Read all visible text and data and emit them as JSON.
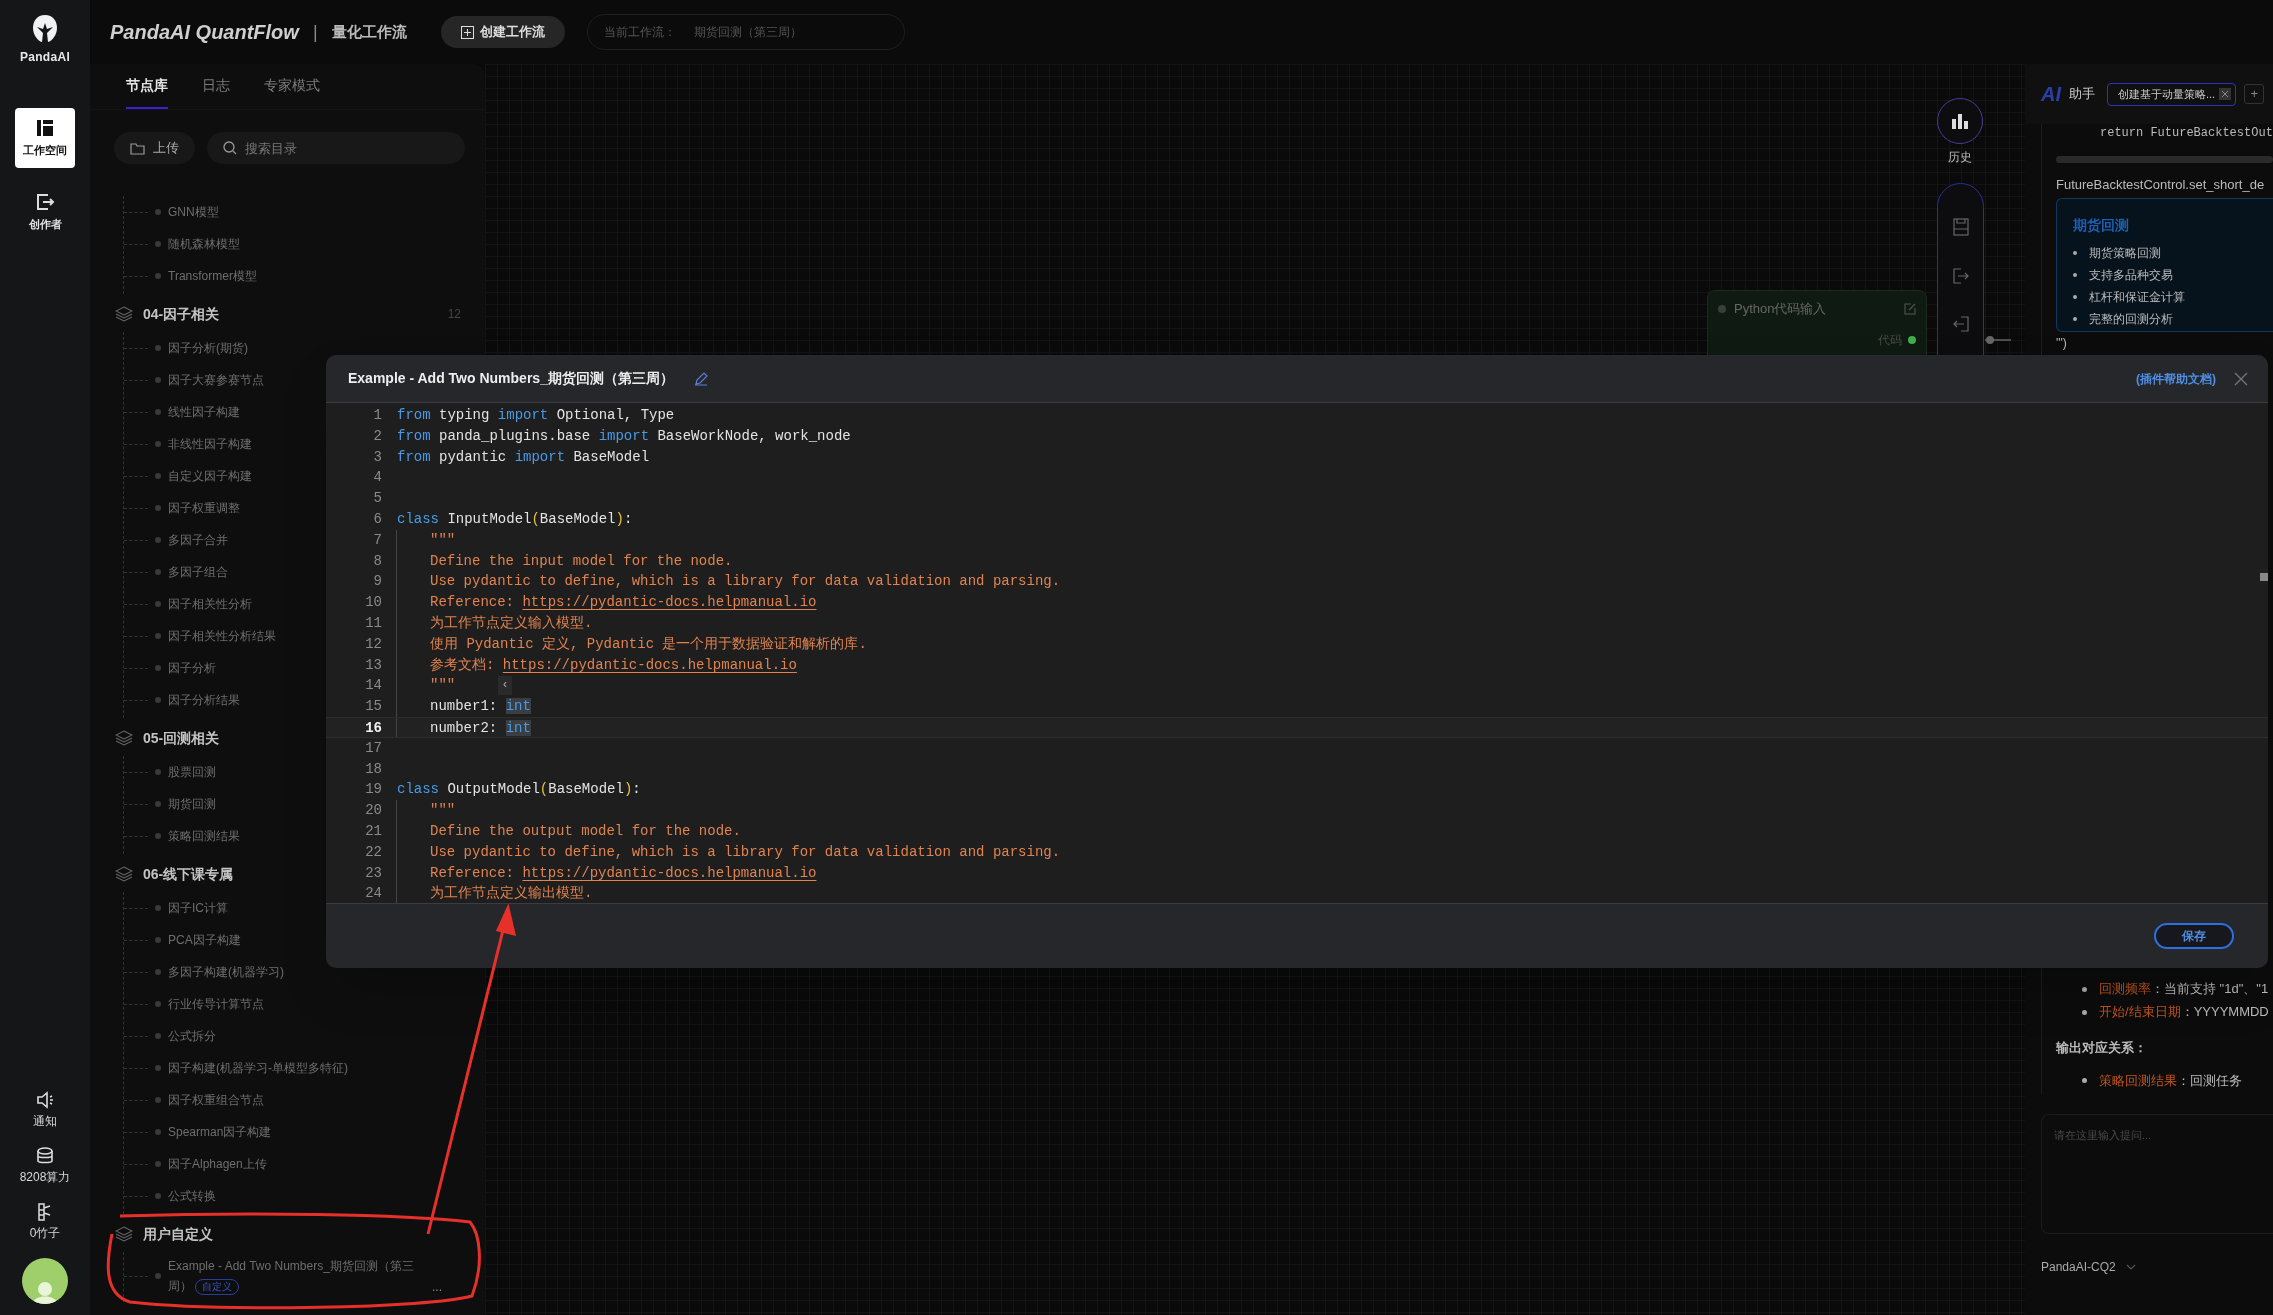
{
  "rail": {
    "logo_text": "PandaAI",
    "top_items": [
      {
        "label": "工作空间",
        "selected": true
      },
      {
        "label": "创作者",
        "selected": false
      }
    ],
    "bottom_items": [
      {
        "label": "通知"
      },
      {
        "label": "8208算力"
      },
      {
        "label": "0竹子"
      }
    ]
  },
  "header": {
    "app_title": "PandaAI QuantFlow",
    "separator": "|",
    "subtitle": "量化工作流",
    "create_button": "创建工作流",
    "current_label": "当前工作流：",
    "current_value": "期货回测（第三周）"
  },
  "library": {
    "tabs": [
      {
        "label": "节点库",
        "selected": true
      },
      {
        "label": "日志",
        "selected": false
      },
      {
        "label": "专家模式",
        "selected": false
      }
    ],
    "upload_button": "上传",
    "search": {
      "placeholder": "搜索目录"
    },
    "groups": [
      {
        "items": [
          {
            "label": "GNN模型"
          },
          {
            "label": "随机森林模型"
          },
          {
            "label": "Transformer模型"
          }
        ]
      },
      {
        "title": "04-因子相关",
        "count": "12",
        "items": [
          {
            "label": "因子分析(期货)"
          },
          {
            "label": "因子大赛参赛节点"
          },
          {
            "label": "线性因子构建"
          },
          {
            "label": "非线性因子构建"
          },
          {
            "label": "自定义因子构建"
          },
          {
            "label": "因子权重调整"
          },
          {
            "label": "多因子合并"
          },
          {
            "label": "多因子组合"
          },
          {
            "label": "因子相关性分析"
          },
          {
            "label": "因子相关性分析结果"
          },
          {
            "label": "因子分析"
          },
          {
            "label": "因子分析结果"
          }
        ]
      },
      {
        "title": "05-回测相关",
        "items": [
          {
            "label": "股票回测"
          },
          {
            "label": "期货回测"
          },
          {
            "label": "策略回测结果"
          }
        ]
      },
      {
        "title": "06-线下课专属",
        "items": [
          {
            "label": "因子IC计算"
          },
          {
            "label": "PCA因子构建"
          },
          {
            "label": "多因子构建(机器学习)"
          },
          {
            "label": "行业传导计算节点"
          },
          {
            "label": "公式拆分"
          },
          {
            "label": "因子构建(机器学习-单模型多特征)"
          },
          {
            "label": "因子权重组合节点"
          },
          {
            "label": "Spearman因子构建"
          },
          {
            "label": "因子Alphagen上传"
          },
          {
            "label": "公式转换"
          }
        ]
      },
      {
        "title": "用户自定义",
        "items": [
          {
            "label": "Example - Add Two Numbers_期货回测（第三周）",
            "tag": "自定义",
            "more": "..."
          }
        ]
      }
    ]
  },
  "canvas": {
    "history_label": "历史",
    "node": {
      "title": "Python代码输入",
      "port": "代码"
    }
  },
  "assistant": {
    "logo": "AI",
    "title": "助手",
    "chat_tab": "创建基于动量策略...",
    "add_button": "+",
    "code_line": "return FutureBacktestOut",
    "control_line": "FutureBacktestControl.set_short_de",
    "card": {
      "title": "期货回测",
      "bullets": [
        "期货策略回测",
        "支持多品种交易",
        "杠杆和保证金计算",
        "完整的回测分析"
      ]
    },
    "closing": "''')",
    "params": [
      {
        "key": "回测频率",
        "text": "：当前支持 \"1d\"、\"1"
      },
      {
        "key": "开始/结束日期",
        "text": "：YYYYMMDD"
      }
    ],
    "output_heading": "输出对应关系：",
    "outputs": [
      {
        "key": "策略回测结果",
        "text": "：回测任务"
      }
    ],
    "input": {
      "placeholder": "请在这里输入提问..."
    },
    "model": "PandaAI-CQ2"
  },
  "editor": {
    "title": "Example - Add Two Numbers_期货回测（第三周）",
    "help_link": "(插件帮助文档)",
    "save_button": "保存",
    "collapse_handle": "‹",
    "lines": [
      {
        "n": "1",
        "current": false,
        "block": false,
        "tokens": [
          {
            "kind": "kw",
            "text": "from"
          },
          {
            "kind": "plain",
            "text": " typing "
          },
          {
            "kind": "kw",
            "text": "import"
          },
          {
            "kind": "plain",
            "text": " Optional, Type"
          }
        ]
      },
      {
        "n": "2",
        "current": false,
        "block": false,
        "tokens": [
          {
            "kind": "kw",
            "text": "from"
          },
          {
            "kind": "plain",
            "text": " panda_plugins.base "
          },
          {
            "kind": "kw",
            "text": "import"
          },
          {
            "kind": "plain",
            "text": " BaseWorkNode, work_node"
          }
        ]
      },
      {
        "n": "3",
        "current": false,
        "block": false,
        "tokens": [
          {
            "kind": "kw",
            "text": "from"
          },
          {
            "kind": "plain",
            "text": " pydantic "
          },
          {
            "kind": "kw",
            "text": "import"
          },
          {
            "kind": "plain",
            "text": " BaseModel"
          }
        ]
      },
      {
        "n": "4",
        "current": false,
        "block": false
      },
      {
        "n": "5",
        "current": false,
        "block": false
      },
      {
        "n": "6",
        "current": false,
        "block": false,
        "tokens": [
          {
            "kind": "kw",
            "text": "class"
          },
          {
            "kind": "plain",
            "text": " InputModel"
          },
          {
            "kind": "paren",
            "text": "("
          },
          {
            "kind": "plain",
            "text": "BaseModel"
          },
          {
            "kind": "paren",
            "text": ")"
          },
          {
            "kind": "plain",
            "text": ":"
          }
        ]
      },
      {
        "n": "7",
        "current": false,
        "block": true,
        "tokens": [
          {
            "kind": "str",
            "text": "\"\"\""
          }
        ]
      },
      {
        "n": "8",
        "current": false,
        "block": true,
        "tokens": [
          {
            "kind": "str",
            "text": "Define the input model for the node."
          }
        ]
      },
      {
        "n": "9",
        "current": false,
        "block": true,
        "tokens": [
          {
            "kind": "str",
            "text": "Use pydantic to define, which is a library for data validation and parsing."
          }
        ]
      },
      {
        "n": "10",
        "current": false,
        "block": true,
        "tokens": [
          {
            "kind": "str",
            "text": "Reference: "
          },
          {
            "kind": "link",
            "text": "https://pydantic-docs.helpmanual.io"
          }
        ]
      },
      {
        "n": "11",
        "current": false,
        "block": true,
        "tokens": [
          {
            "kind": "str",
            "text": "为工作节点定义输入模型."
          }
        ]
      },
      {
        "n": "12",
        "current": false,
        "block": true,
        "tokens": [
          {
            "kind": "str",
            "text": "使用 Pydantic 定义, Pydantic 是一个用于数据验证和解析的库."
          }
        ]
      },
      {
        "n": "13",
        "current": false,
        "block": true,
        "tokens": [
          {
            "kind": "str",
            "text": "参考文档: "
          },
          {
            "kind": "link",
            "text": "https://pydantic-docs.helpmanual.io"
          }
        ]
      },
      {
        "n": "14",
        "current": false,
        "block": true,
        "tokens": [
          {
            "kind": "str",
            "text": "\"\"\""
          }
        ]
      },
      {
        "n": "15",
        "current": false,
        "block": true,
        "tokens": [
          {
            "kind": "plain",
            "text": "number1: "
          },
          {
            "kind": "type",
            "text": "int"
          }
        ]
      },
      {
        "n": "16",
        "current": true,
        "block": true,
        "tokens": [
          {
            "kind": "plain",
            "text": "number2: "
          },
          {
            "kind": "type",
            "text": "int"
          }
        ]
      },
      {
        "n": "17",
        "current": false,
        "block": false
      },
      {
        "n": "18",
        "current": false,
        "block": false
      },
      {
        "n": "19",
        "current": false,
        "block": false,
        "tokens": [
          {
            "kind": "kw",
            "text": "class"
          },
          {
            "kind": "plain",
            "text": " OutputModel"
          },
          {
            "kind": "paren",
            "text": "("
          },
          {
            "kind": "plain",
            "text": "BaseModel"
          },
          {
            "kind": "paren",
            "text": ")"
          },
          {
            "kind": "plain",
            "text": ":"
          }
        ]
      },
      {
        "n": "20",
        "current": false,
        "block": true,
        "tokens": [
          {
            "kind": "str",
            "text": "\"\"\""
          }
        ]
      },
      {
        "n": "21",
        "current": false,
        "block": true,
        "tokens": [
          {
            "kind": "str",
            "text": "Define the output model for the node."
          }
        ]
      },
      {
        "n": "22",
        "current": false,
        "block": true,
        "tokens": [
          {
            "kind": "str",
            "text": "Use pydantic to define, which is a library for data validation and parsing."
          }
        ]
      },
      {
        "n": "23",
        "current": false,
        "block": true,
        "tokens": [
          {
            "kind": "str",
            "text": "Reference: "
          },
          {
            "kind": "link",
            "text": "https://pydantic-docs.helpmanual.io"
          }
        ]
      },
      {
        "n": "24",
        "current": false,
        "block": true,
        "tokens": [
          {
            "kind": "str",
            "text": "为工作节点定义输出模型."
          }
        ]
      }
    ]
  }
}
